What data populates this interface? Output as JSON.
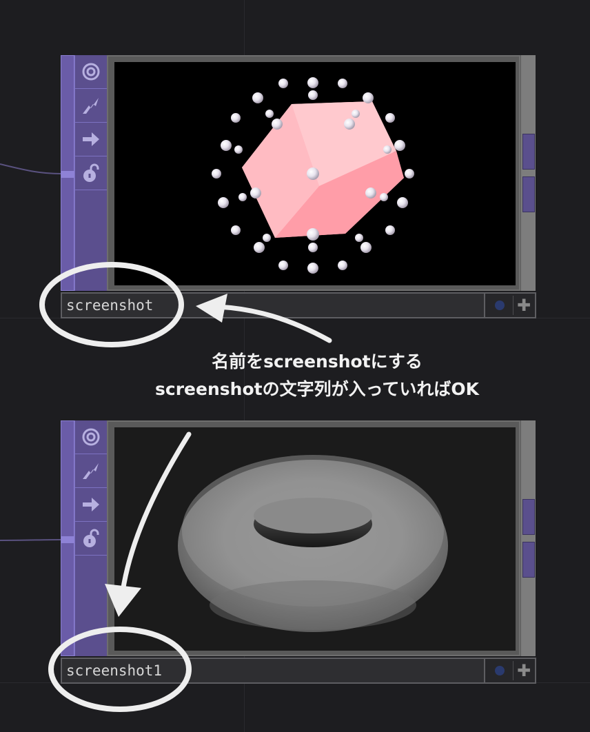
{
  "nodes": [
    {
      "name": "screenshot",
      "content": "pink-cube-with-spheres",
      "viewer_background": "#000000",
      "tools": [
        "viewer-icon",
        "cook-icon",
        "export-icon",
        "unlock-icon"
      ]
    },
    {
      "name": "screenshot1",
      "content": "gray-torus",
      "viewer_background": "#1b1b1b",
      "tools": [
        "viewer-icon",
        "cook-icon",
        "export-icon",
        "unlock-icon"
      ]
    }
  ],
  "annotation": {
    "line1": "名前をscreenshotにする",
    "line2": "screenshotの文字列が入っていればOK"
  },
  "colors": {
    "node_purple": "#5b4f8e",
    "node_purple_light": "#6a5ca8",
    "annotation_white": "#f2f2f2",
    "cube_pink": "#ffb0b8"
  }
}
